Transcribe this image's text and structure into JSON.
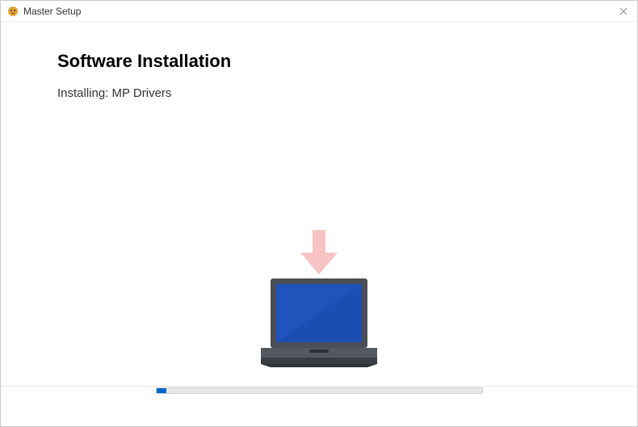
{
  "window": {
    "title": "Master Setup"
  },
  "heading": "Software Installation",
  "status": {
    "prefix": "Installing: ",
    "item": "MP Drivers",
    "full": "Installing: MP Drivers"
  },
  "progress": {
    "percent": 3
  },
  "colors": {
    "arrow": "#f7c3c3",
    "screen": "#1b4db3",
    "laptop_body": "#4a4e56",
    "laptop_base": "#3a3e44",
    "progress_fill": "#0066cc",
    "progress_bg": "#e8e8e8"
  }
}
